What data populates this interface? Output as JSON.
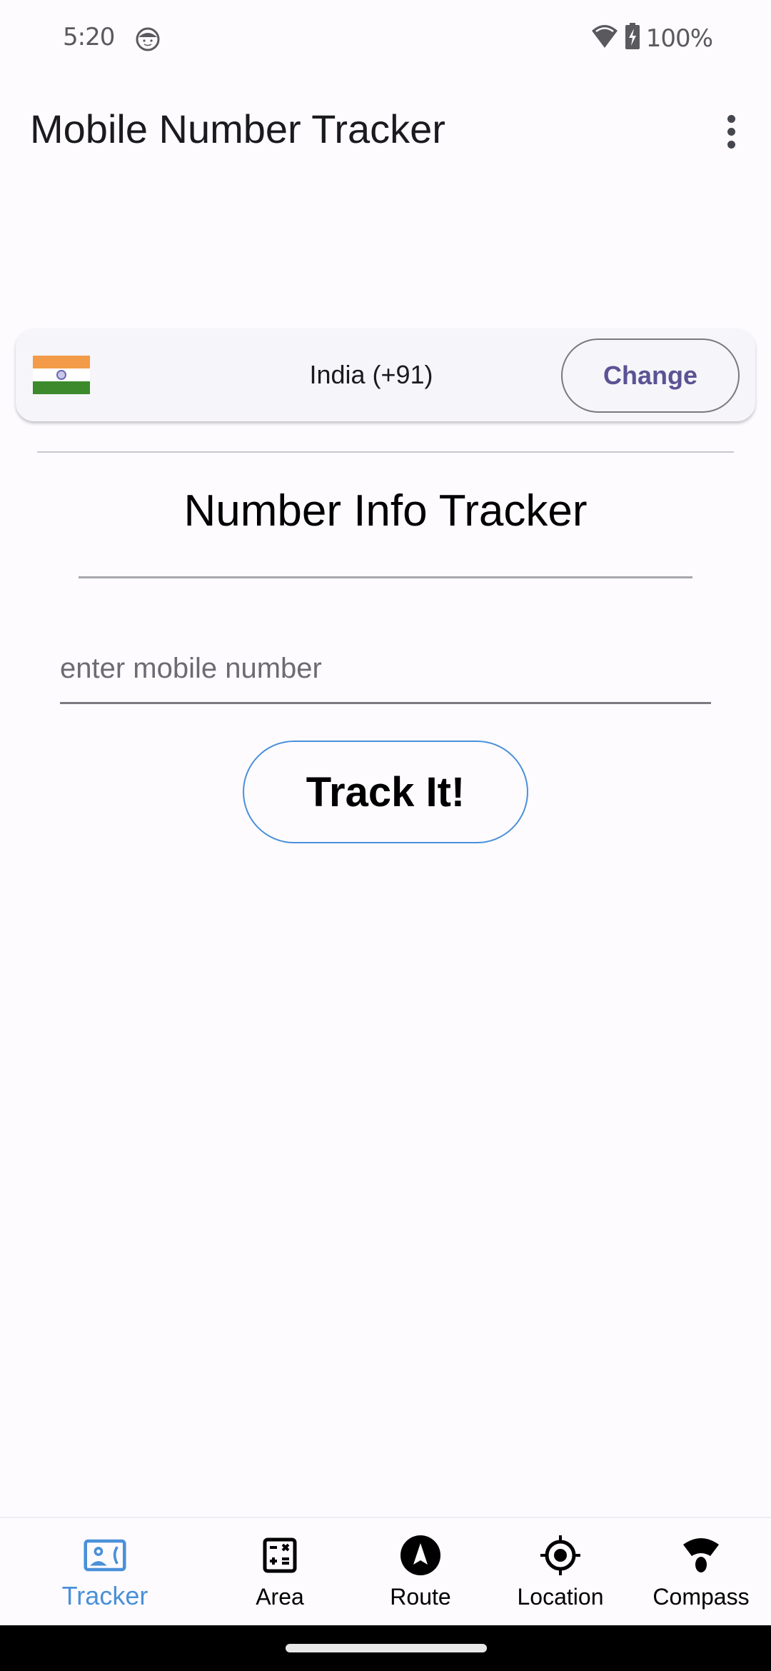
{
  "status_bar": {
    "time": "5:20",
    "notification_icon": "face-icon",
    "wifi_icon": "wifi-icon",
    "battery_icon": "battery-charging-icon",
    "battery_percent": "100%"
  },
  "app_bar": {
    "title": "Mobile Number Tracker",
    "overflow_icon": "more-vert-icon"
  },
  "country_selector": {
    "flag_icon": "india-flag-icon",
    "country": "India (+91)",
    "change_label": "Change"
  },
  "main": {
    "section_title": "Number Info Tracker",
    "number_input": {
      "value": "",
      "placeholder": "enter mobile number"
    },
    "track_button_label": "Track It!"
  },
  "bottom_nav": {
    "active_color": "#4a90d9",
    "items": [
      {
        "label": "Tracker",
        "icon": "contact-phone-icon",
        "active": true
      },
      {
        "label": "Area",
        "icon": "calculate-icon",
        "active": false
      },
      {
        "label": "Route",
        "icon": "navigation-icon",
        "active": false
      },
      {
        "label": "Location",
        "icon": "my-location-icon",
        "active": false
      },
      {
        "label": "Compass",
        "icon": "compass-icon",
        "active": false
      }
    ]
  }
}
